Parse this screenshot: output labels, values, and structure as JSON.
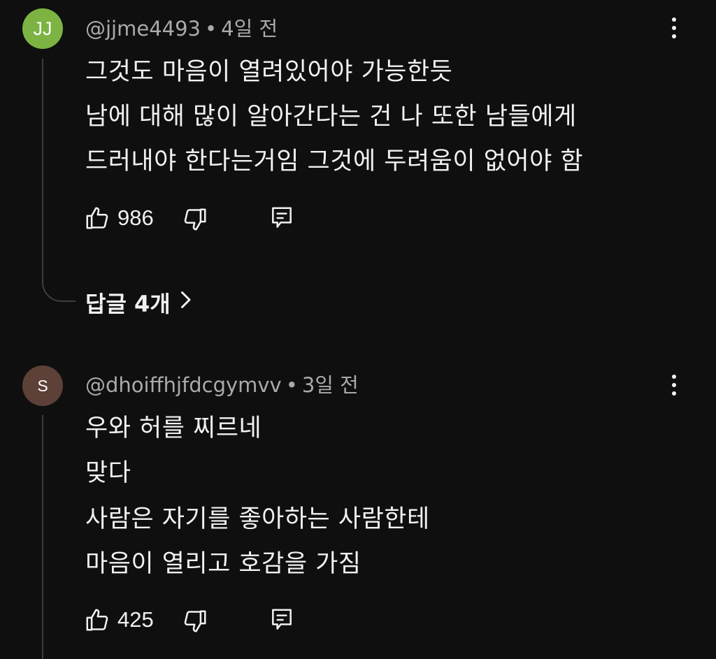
{
  "comments": [
    {
      "avatar_text": "JJ",
      "avatar_color": "#7cb342",
      "author": "@jjme4493",
      "separator": "•",
      "time": "4일 전",
      "lines": [
        "그것도 마음이 열려있어야 가능한듯",
        "남에 대해 많이 알아간다는 건 나 또한 남들에게",
        "드러내야 한다는거임 그것에 두려움이 없어야 함"
      ],
      "likes": "986",
      "replies_label": "답글 4개"
    },
    {
      "avatar_text": "S",
      "avatar_color": "#5d4037",
      "author": "@dhoiffhjfdcgymvv",
      "separator": "•",
      "time": "3일 전",
      "lines": [
        "우와 허를 찌르네",
        "맞다",
        "사람은 자기를 좋아하는 사람한테",
        "마음이 열리고 호감을 가짐"
      ],
      "likes": "425"
    }
  ],
  "icons": {
    "like": "thumbs-up-icon",
    "dislike": "thumbs-down-icon",
    "reply": "reply-icon",
    "more": "more-vertical-icon",
    "chevron": "chevron-right-icon"
  }
}
